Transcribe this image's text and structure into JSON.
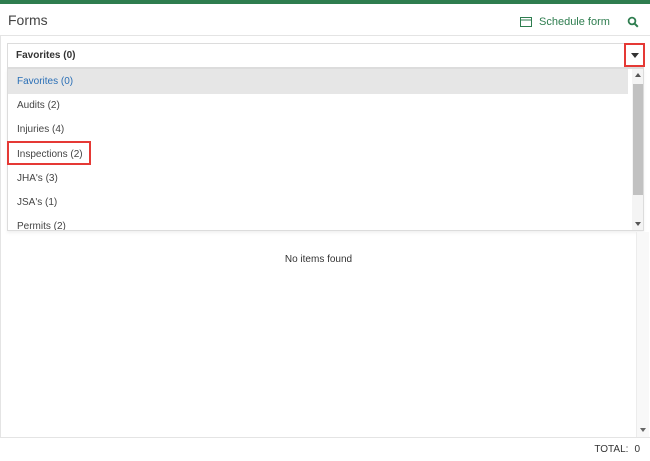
{
  "colors": {
    "brand": "#2e7d4f",
    "accent_link": "#2a6fb6",
    "highlight": "#e53935"
  },
  "header": {
    "title": "Forms",
    "schedule_label": "Schedule form",
    "schedule_icon": "calendar-icon",
    "search_icon": "search-icon"
  },
  "select": {
    "value": "Favorites (0)"
  },
  "dropdown": {
    "options": [
      {
        "label": "Favorites (0)",
        "selected": true
      },
      {
        "label": "Audits (2)"
      },
      {
        "label": "Injuries (4)"
      },
      {
        "label": "Inspections (2)"
      },
      {
        "label": "JHA's (3)"
      },
      {
        "label": "JSA's (1)"
      },
      {
        "label": "Permits (2)"
      }
    ]
  },
  "content": {
    "empty_message": "No items found"
  },
  "footer": {
    "total_label": "TOTAL:",
    "total_value": "0"
  }
}
